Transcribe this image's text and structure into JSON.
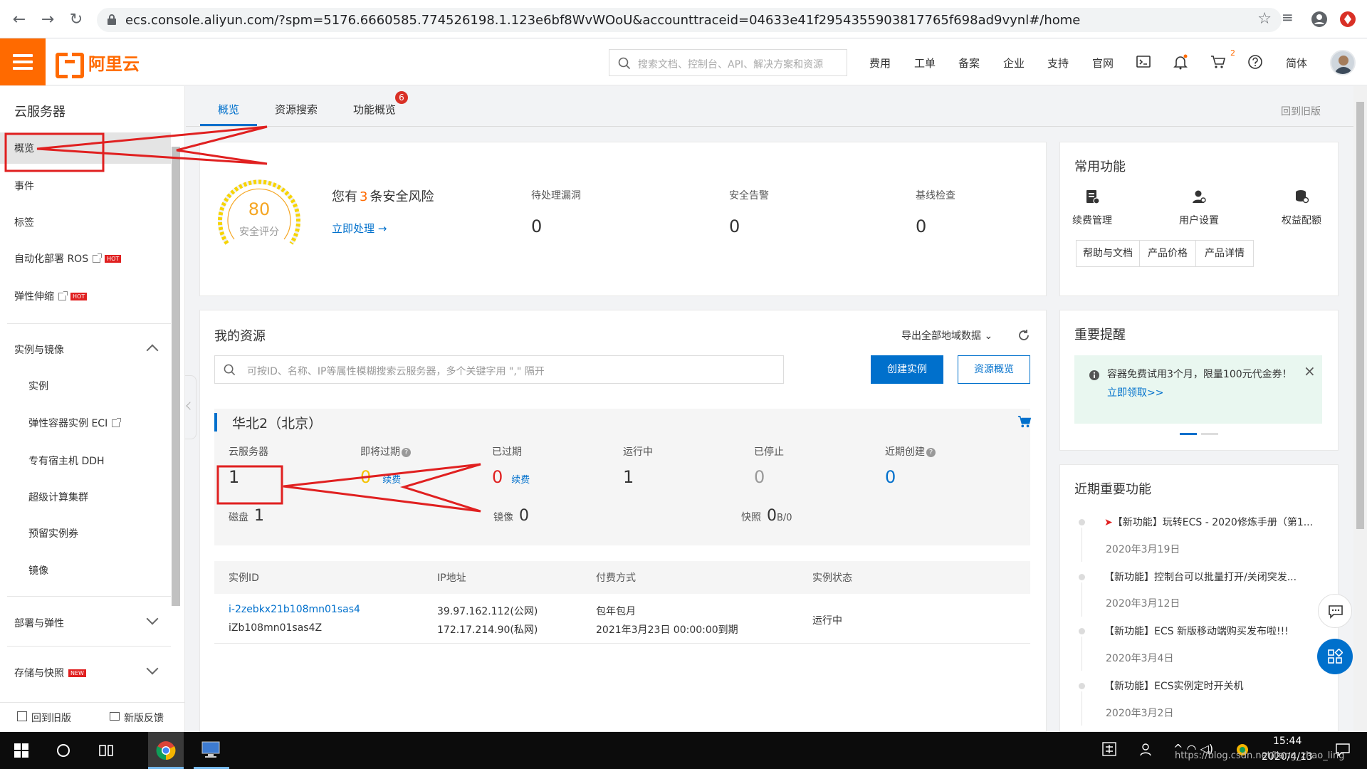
{
  "browser": {
    "url": "ecs.console.aliyun.com/?spm=5176.6660585.774526198.1.123e6bf8WvWOoU&accounttraceid=04633e41f2954355903817765f698ad9vynl#/home"
  },
  "header": {
    "brand": "阿里云",
    "search_placeholder": "搜索文档、控制台、API、解决方案和资源",
    "nav": [
      "费用",
      "工单",
      "备案",
      "企业",
      "支持",
      "官网"
    ],
    "cart_count": "2",
    "lang": "简体"
  },
  "sidebar": {
    "title": "云服务器",
    "items": [
      {
        "label": "概览"
      },
      {
        "label": "事件"
      },
      {
        "label": "标签"
      },
      {
        "label": "自动化部署 ROS",
        "tag": "HOT"
      },
      {
        "label": "弹性伸缩",
        "tag": "HOT"
      }
    ],
    "section_instances": "实例与镜像",
    "sub_items": [
      "实例",
      "弹性容器实例 ECI",
      "专有宿主机 DDH",
      "超级计算集群",
      "预留实例券",
      "镜像"
    ],
    "section_deploy": "部署与弹性",
    "section_storage": "存储与快照",
    "storage_tag": "NEW",
    "footer_back": "回到旧版",
    "footer_feedback": "新版反馈"
  },
  "tabs": {
    "items": [
      "概览",
      "资源搜索",
      "功能概览"
    ],
    "badge": "6",
    "back_old": "回到旧版"
  },
  "security": {
    "score": "80",
    "score_label": "安全评分",
    "risk_prefix": "您有",
    "risk_count": "3",
    "risk_suffix": "条安全风险",
    "action": "立即处理",
    "stats": [
      {
        "label": "待处理漏洞",
        "value": "0"
      },
      {
        "label": "安全告警",
        "value": "0"
      },
      {
        "label": "基线检查",
        "value": "0"
      }
    ]
  },
  "resources": {
    "title": "我的资源",
    "export": "导出全部地域数据",
    "search_placeholder": "可按ID、名称、IP等属性模糊搜索云服务器，多个关键字用 \",\" 隔开",
    "create_button": "创建实例",
    "overview_button": "资源概览",
    "region": "华北2（北京）",
    "stats": [
      {
        "label": "云服务器",
        "value": "1"
      },
      {
        "label": "即将过期",
        "value": "0",
        "renew": "续费"
      },
      {
        "label": "已过期",
        "value": "0",
        "renew": "续费"
      },
      {
        "label": "运行中",
        "value": "1"
      },
      {
        "label": "已停止",
        "value": "0"
      },
      {
        "label": "近期创建",
        "value": "0"
      }
    ],
    "disk_label": "磁盘",
    "disk_value": "1",
    "image_label": "镜像",
    "image_value": "0",
    "snapshot_label": "快照",
    "snapshot_value": "0",
    "snapshot_unit": "B/0",
    "table": {
      "headers": [
        "实例ID",
        "IP地址",
        "付费方式",
        "实例状态"
      ],
      "rows": [
        {
          "id": "i-2zebkx21b108mn01sas4",
          "name": "iZb108mn01sas4Z",
          "ip_public": "39.97.162.112(公网)",
          "ip_private": "172.17.214.90(私网)",
          "billing": "包年包月",
          "expire": "2021年3月23日 00:00:00到期",
          "status": "运行中"
        }
      ]
    }
  },
  "common": {
    "title": "常用功能",
    "quick": [
      "续费管理",
      "用户设置",
      "权益配额"
    ],
    "buttons": [
      "帮助与文档",
      "产品价格",
      "产品详情"
    ]
  },
  "reminder": {
    "title": "重要提醒",
    "text": "容器免费试用3个月，限量100元代金券！",
    "link": "立即领取>>"
  },
  "recent": {
    "title": "近期重要功能",
    "items": [
      {
        "text": "【新功能】玩转ECS - 2020修炼手册（第1...",
        "date": "2020年3月19日"
      },
      {
        "text": "【新功能】控制台可以批量打开/关闭突发...",
        "date": "2020年3月12日"
      },
      {
        "text": "【新功能】ECS 新版移动端购买发布啦!!!",
        "date": "2020年3月4日"
      },
      {
        "text": "【新功能】ECS实例定时开关机",
        "date": "2020年3月2日"
      }
    ]
  },
  "taskbar": {
    "time": "15:44",
    "date": "2020/4/13",
    "watermark": "https://blog.csdn.net/liang_zhao_ling"
  },
  "colors": {
    "brand": "#ff6a00",
    "primary": "#0070cc",
    "annotation": "#e02020"
  }
}
